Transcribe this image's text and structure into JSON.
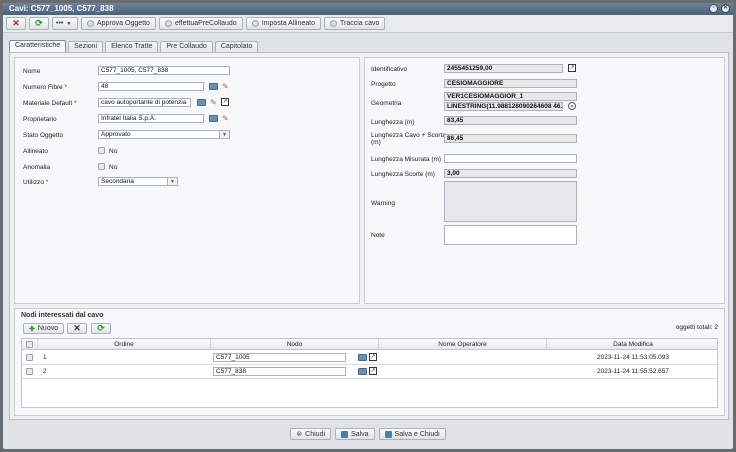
{
  "window": {
    "title": "Cavi: C577_1005, C577_838"
  },
  "toolbar": {
    "approva": "Approva Oggetto",
    "precollaudo": "effettuaPreCollaudo",
    "allineato": "Imposta Allineato",
    "traccia": "Traccia cavo",
    "more": "•••"
  },
  "tabs": [
    "Caratteristiche",
    "Sezioni",
    "Elenco Tratte",
    "Pre Collaudo",
    "Capitolato"
  ],
  "left": {
    "nome": {
      "label": "Nome",
      "value": "C577_1005, C577_838"
    },
    "fibre": {
      "label": "Numero Fibre",
      "value": "48"
    },
    "materiale": {
      "label": "Materiale Default",
      "value": "cavo autoportante di potenzia"
    },
    "proprietario": {
      "label": "Proprietario",
      "value": "Infratel Italia S.p.A."
    },
    "stato": {
      "label": "Stato Oggetto",
      "value": "Approvato"
    },
    "allineato": {
      "label": "Allineato",
      "value": "No"
    },
    "anomalia": {
      "label": "Anomalia",
      "value": "No"
    },
    "utilizzo": {
      "label": "Utilizzo",
      "value": "Secondaria"
    },
    "required_mark": "*"
  },
  "right": {
    "identificativo": {
      "label": "Identificativo",
      "value": "2455451259,00"
    },
    "progetto": {
      "label": "Progetto",
      "value": "CESIOMAGGIORE"
    },
    "geometria": {
      "label": "Geometria",
      "value1": "VER1CESIOMAGGIOR_1",
      "value2": "LINESTRING(11.988128090264608 46.0"
    },
    "lunghezza": {
      "label": "Lunghezza (m)",
      "value": "83,45"
    },
    "lunghezza_scorta": {
      "label1": "Lunghezza Cavo + Scorta",
      "label2": "(m)",
      "value": "86,45"
    },
    "misurata": {
      "label": "Lunghezza Misurata (m)",
      "value": ""
    },
    "scorte": {
      "label": "Lunghezza Scorte (m)",
      "value": "3,00"
    },
    "warning": {
      "label": "Warning"
    },
    "note": {
      "label": "Note"
    }
  },
  "nodes": {
    "title": "Nodi interessati dal cavo",
    "new_button": "Nuovo",
    "count_label": "oggetti totali: 2",
    "headers": {
      "ordine": "Ordine",
      "nodo": "Nodo",
      "operatore": "Nome Operatore",
      "data": "Data Modifica"
    },
    "rows": [
      {
        "ordine": "1",
        "nodo": "C577_1005",
        "operatore": "",
        "data": "2023-11-24 11:53:05.093"
      },
      {
        "ordine": "2",
        "nodo": "C577_838",
        "operatore": "",
        "data": "2023-11-24 11:55:52.657"
      }
    ]
  },
  "footer": {
    "chiudi": "Chiudi",
    "salva": "Salva",
    "salva_chiudi": "Salva e Chiudi"
  }
}
